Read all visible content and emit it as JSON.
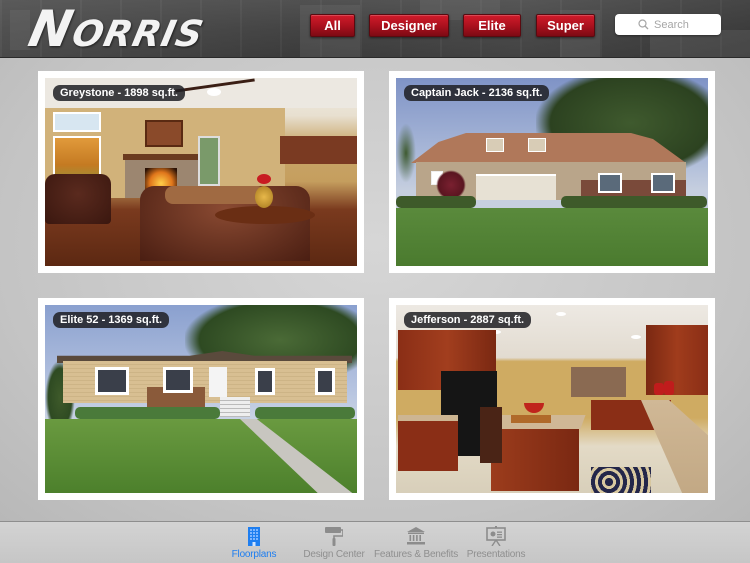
{
  "header": {
    "logo_text_big": "N",
    "logo_text_small": "ORRIS",
    "filters": [
      {
        "label": "All"
      },
      {
        "label": "Designer"
      },
      {
        "label": "Elite"
      },
      {
        "label": "Super"
      }
    ],
    "search": {
      "placeholder": "Search",
      "value": "",
      "icon": "search-icon"
    }
  },
  "homes": [
    {
      "label": "Greystone - 1898 sq.ft.",
      "scene": "living-room"
    },
    {
      "label": "Captain Jack - 2136 sq.ft.",
      "scene": "house-exterior"
    },
    {
      "label": "Elite 52 - 1369 sq.ft.",
      "scene": "house-exterior"
    },
    {
      "label": "Jefferson - 2887 sq.ft.",
      "scene": "kitchen"
    }
  ],
  "tabbar": {
    "active_color": "#1e7ef0",
    "inactive_color": "#8f8f8f",
    "tabs": [
      {
        "label": "Floorplans",
        "icon": "building-icon",
        "active": true
      },
      {
        "label": "Design Center",
        "icon": "paint-roller-icon",
        "active": false
      },
      {
        "label": "Features & Benefits",
        "icon": "bank-icon",
        "active": false
      },
      {
        "label": "Presentations",
        "icon": "presentation-board-icon",
        "active": false
      }
    ]
  },
  "colors": {
    "filter_button": "#b01220",
    "label_pill": "#1e1e23"
  }
}
